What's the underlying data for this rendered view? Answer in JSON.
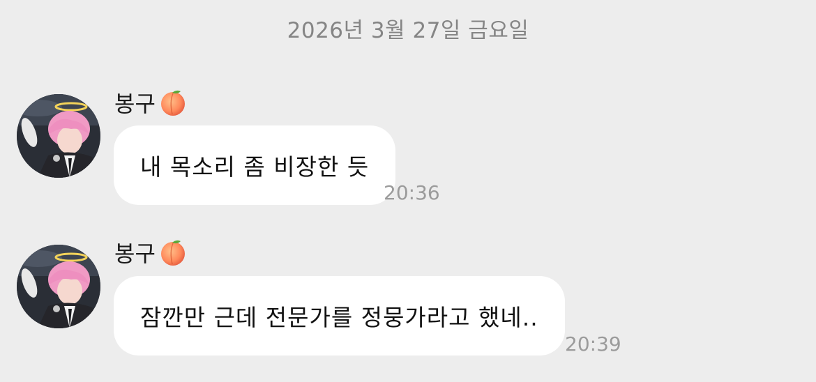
{
  "date_divider": "2026년 3월 27일 금요일",
  "messages": [
    {
      "sender": "봉구",
      "sender_emoji": "peach-icon",
      "text": "내 목소리 좀 비장한 듯",
      "time": "20:36"
    },
    {
      "sender": "봉구",
      "sender_emoji": "peach-icon",
      "text": "잠깐만 근데 전문가를 정뭉가라고 했네..",
      "time": "20:39"
    }
  ],
  "colors": {
    "background": "#ededed",
    "bubble": "#ffffff",
    "timestamp": "#9b9b9b",
    "date_divider": "#858585"
  }
}
